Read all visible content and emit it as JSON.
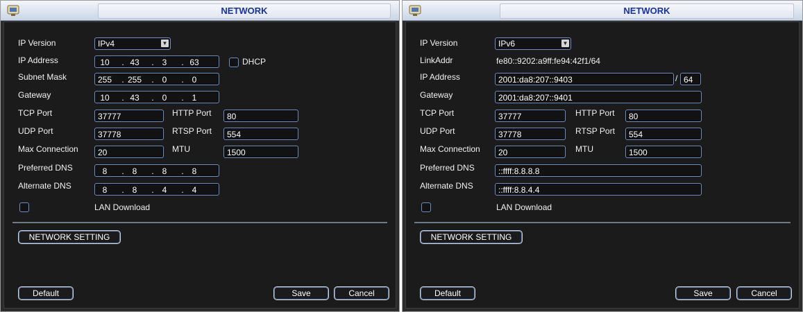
{
  "colors": {
    "title_text": "#1630a8",
    "field_border": "#6a8fc4",
    "panel_bg": "#1b1b1b"
  },
  "left": {
    "title": "NETWORK",
    "icon": "app-icon",
    "ip_version_label": "IP Version",
    "ip_version_value": "IPv4",
    "ip_address_label": "IP Address",
    "ip_address": [
      "10",
      "43",
      "3",
      "63"
    ],
    "dhcp_label": "DHCP",
    "subnet_label": "Subnet Mask",
    "subnet": [
      "255",
      "255",
      "0",
      "0"
    ],
    "gateway_label": "Gateway",
    "gateway": [
      "10",
      "43",
      "0",
      "1"
    ],
    "tcp_port_label": "TCP Port",
    "tcp_port": "37777",
    "http_port_label": "HTTP Port",
    "http_port": "80",
    "udp_port_label": "UDP Port",
    "udp_port": "37778",
    "rtsp_port_label": "RTSP Port",
    "rtsp_port": "554",
    "max_conn_label": "Max Connection",
    "max_conn": "20",
    "mtu_label": "MTU",
    "mtu": "1500",
    "pref_dns_label": "Preferred DNS",
    "pref_dns": [
      "8",
      "8",
      "8",
      "8"
    ],
    "alt_dns_label": "Alternate DNS",
    "alt_dns": [
      "8",
      "8",
      "4",
      "4"
    ],
    "lan_download_label": "LAN Download",
    "network_setting_button": "NETWORK SETTING",
    "default_button": "Default",
    "save_button": "Save",
    "cancel_button": "Cancel"
  },
  "right": {
    "title": "NETWORK",
    "icon": "app-icon",
    "ip_version_label": "IP Version",
    "ip_version_value": "IPv6",
    "link_addr_label": "LinkAddr",
    "link_addr": "fe80::9202:a9ff:fe94:42f1/64",
    "ip_address_label": "IP Address",
    "ip_address": "2001:da8:207::9403",
    "prefix_sep": "/",
    "prefix": "64",
    "gateway_label": "Gateway",
    "gateway": "2001:da8:207::9401",
    "tcp_port_label": "TCP Port",
    "tcp_port": "37777",
    "http_port_label": "HTTP Port",
    "http_port": "80",
    "udp_port_label": "UDP Port",
    "udp_port": "37778",
    "rtsp_port_label": "RTSP Port",
    "rtsp_port": "554",
    "max_conn_label": "Max Connection",
    "max_conn": "20",
    "mtu_label": "MTU",
    "mtu": "1500",
    "pref_dns_label": "Preferred DNS",
    "pref_dns": "::ffff:8.8.8.8",
    "alt_dns_label": "Alternate DNS",
    "alt_dns": "::ffff:8.8.4.4",
    "lan_download_label": "LAN Download",
    "network_setting_button": "NETWORK SETTING",
    "default_button": "Default",
    "save_button": "Save",
    "cancel_button": "Cancel"
  }
}
